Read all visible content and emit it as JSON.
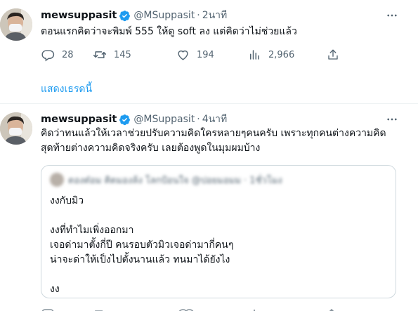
{
  "tweets": [
    {
      "name": "mewsuppasit",
      "handle": "@MSuppasit",
      "separator": "·",
      "time": "2นาที",
      "text": "ตอนแรกคิดว่าจะพิมพ์ 555 ให้ดู soft ลง แต่คิดว่าไม่ช่วยแล้ว",
      "stats": {
        "replies": "28",
        "retweets": "145",
        "likes": "194",
        "views": "2,966"
      },
      "show_thread": "แสดงเธรดนี้"
    },
    {
      "name": "mewsuppasit",
      "handle": "@MSuppasit",
      "separator": "·",
      "time": "4นาที",
      "text_lines": [
        "คิดว่าทนแล้วให้เวลาช่วยปรับความคิดใครหลายๆคนครับ เพราะทุกคนต่างความคิด",
        "สุดท้ายต่างความคิดจริงครับ เลยต้องพูดในมุมผมบ้าง"
      ],
      "quote": {
        "blurred_header": "ตองต๋อม คิดมองล้ง โลกป้อนใจ @ปอยมอมม · 1ชั่วโมง",
        "lines": [
          "งงกับมิว",
          "",
          "งงที่ทำไมเพิ่งออกมา",
          "เจอด่ามาตั้งกี่ปี คนรอบตัวมิวเจอด่ามากี่คนๆ",
          "น่าจะด่าให้เป็งไปตั้งนานแล้ว ทนมาได้ยังไง",
          "",
          "งง"
        ]
      }
    }
  ],
  "icons": {
    "verified": "verified-badge-icon",
    "more": "more-dots-icon",
    "reply": "reply-icon",
    "retweet": "retweet-icon",
    "like": "heart-icon",
    "views": "views-chart-icon",
    "share": "share-icon"
  },
  "colors": {
    "accent": "#1d9bf0",
    "secondary_text": "#536471",
    "border": "#cfd9de"
  }
}
